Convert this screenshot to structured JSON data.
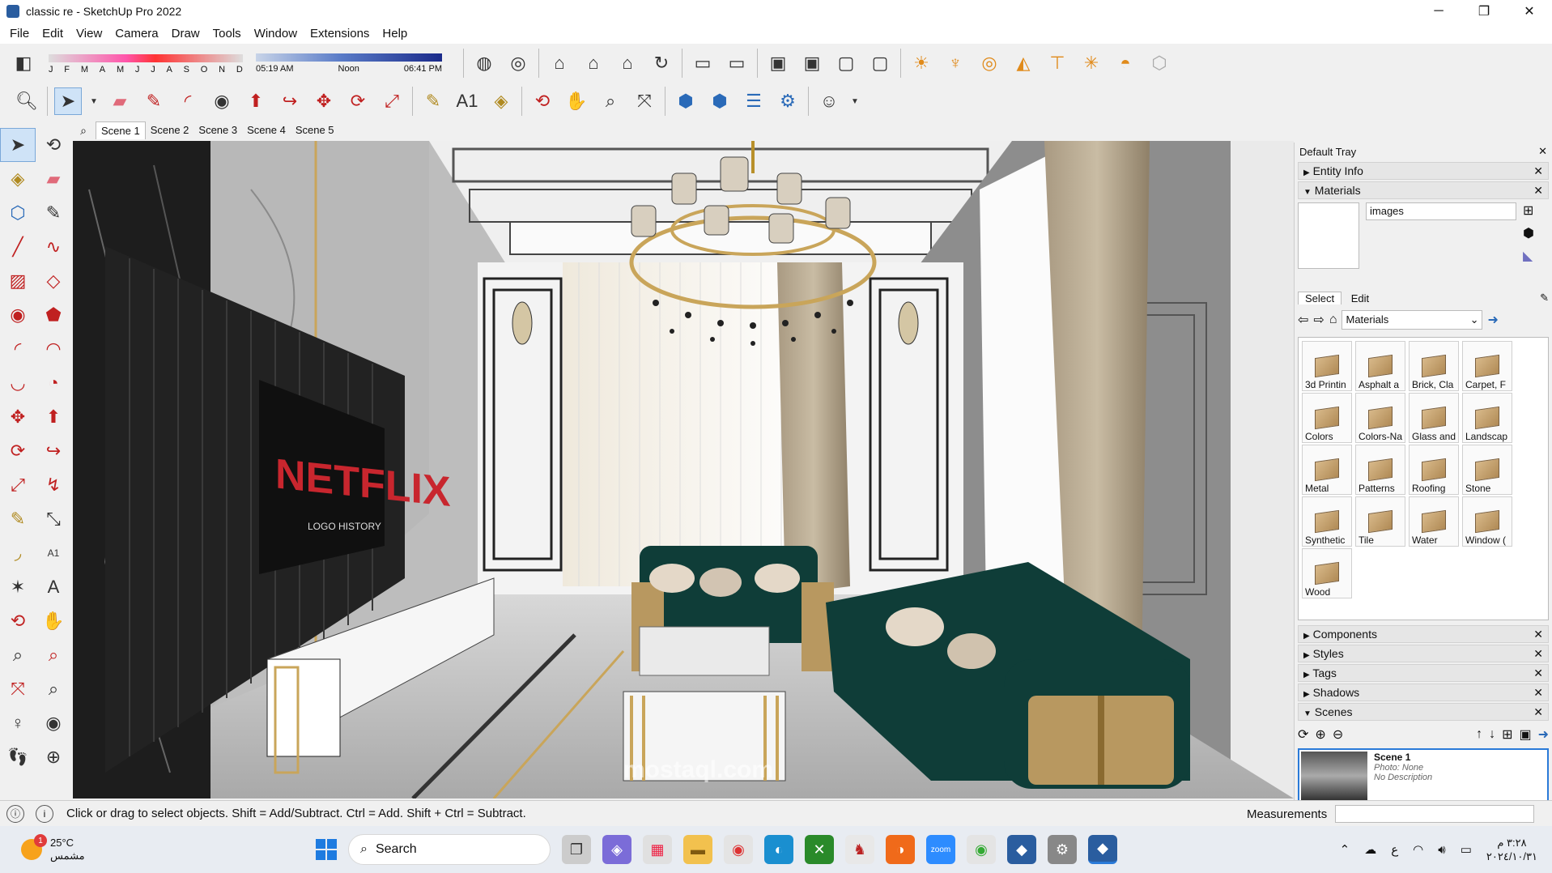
{
  "window": {
    "title": "classic re - SketchUp Pro 2022",
    "minimize": "─",
    "maximize": "❐",
    "close": "✕"
  },
  "menu": [
    "File",
    "Edit",
    "View",
    "Camera",
    "Draw",
    "Tools",
    "Window",
    "Extensions",
    "Help"
  ],
  "shadows_bar": {
    "months": [
      "J",
      "F",
      "M",
      "A",
      "M",
      "J",
      "J",
      "A",
      "S",
      "O",
      "N",
      "D"
    ],
    "time_start": "05:19 AM",
    "time_mid": "Noon",
    "time_end": "06:41 PM"
  },
  "scene_tabs": [
    "Scene 1",
    "Scene 2",
    "Scene 3",
    "Scene 4",
    "Scene 5"
  ],
  "tray": {
    "title": "Default Tray",
    "panels_top": [
      {
        "label": "Entity Info",
        "state": "collapsed"
      },
      {
        "label": "Materials",
        "state": "expanded"
      }
    ],
    "materials": {
      "current_name": "images",
      "tab_select": "Select",
      "tab_edit": "Edit",
      "library": "Materials",
      "items": [
        "3d Printin",
        "Asphalt a",
        "Brick, Cla",
        "Carpet, F",
        "Colors",
        "Colors-Na",
        "Glass and",
        "Landscap",
        "Metal",
        "Patterns",
        "Roofing",
        "Stone",
        "Synthetic",
        "Tile",
        "Water",
        "Window (",
        "Wood"
      ]
    },
    "panels_bottom": [
      {
        "label": "Components",
        "state": "collapsed"
      },
      {
        "label": "Styles",
        "state": "collapsed"
      },
      {
        "label": "Tags",
        "state": "collapsed"
      },
      {
        "label": "Shadows",
        "state": "collapsed"
      },
      {
        "label": "Scenes",
        "state": "expanded"
      }
    ],
    "scene_card": {
      "name": "Scene 1",
      "photo": "Photo: None",
      "description": "No Description"
    }
  },
  "status": {
    "message": "Click or drag to select objects. Shift = Add/Subtract. Ctrl = Add. Shift + Ctrl = Subtract.",
    "measurements_label": "Measurements"
  },
  "viewport": {
    "tv_brand": "NETFLIX",
    "tv_sub": "LOGO HISTORY",
    "watermark": "mostaql.com"
  },
  "taskbar": {
    "weather_temp": "25°C",
    "weather_desc": "مشمس",
    "weather_badge": "1",
    "search_placeholder": "Search",
    "time": "٣:٢٨ م",
    "date": "٢٠٢٤/١٠/٣١",
    "lang": "ع"
  },
  "colors": {
    "accent": "#2a7ad8",
    "sofa": "#0f3d38",
    "gold": "#c9a55a"
  }
}
